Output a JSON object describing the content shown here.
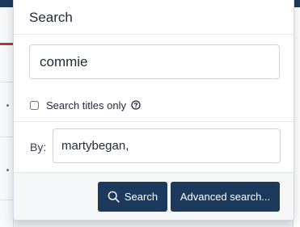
{
  "popup": {
    "title": "Search"
  },
  "query": {
    "value": "commie"
  },
  "titles_only": {
    "label": "Search titles only",
    "checked": false,
    "help_icon": "question-circle-icon"
  },
  "by": {
    "label": "By:",
    "value": "martybegan,"
  },
  "buttons": {
    "search_label": "Search",
    "search_icon": "search-icon",
    "advanced_label": "Advanced search..."
  },
  "colors": {
    "primary": "#1d3a5c",
    "accent_red": "#b23a3a"
  }
}
